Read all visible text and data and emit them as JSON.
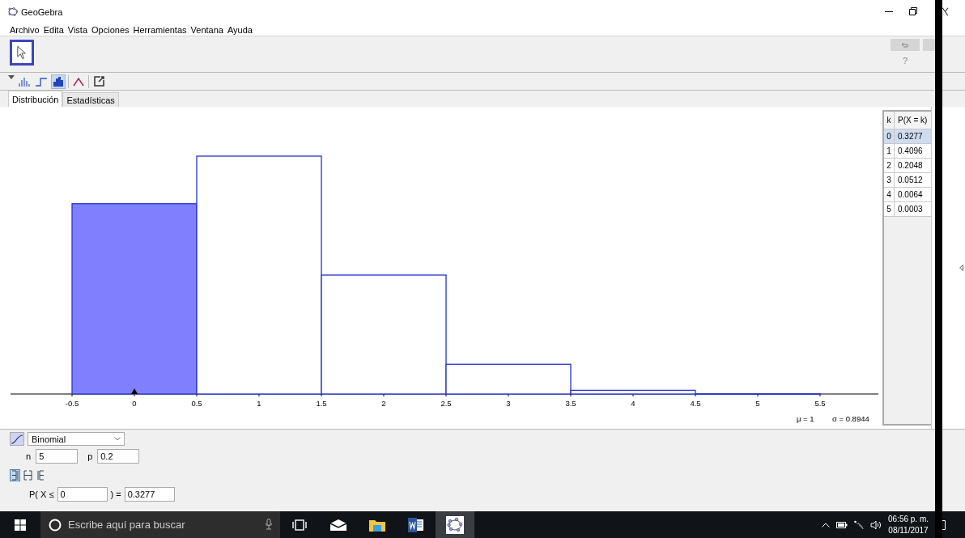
{
  "window": {
    "title": "GeoGebra"
  },
  "menu": [
    "Archivo",
    "Edita",
    "Vista",
    "Opciones",
    "Herramientas",
    "Ventana",
    "Ayuda"
  ],
  "help": "?",
  "view_buttons": [
    {
      "kind": "bars",
      "selected": false
    },
    {
      "kind": "step",
      "selected": false
    },
    {
      "kind": "histogram",
      "selected": true
    },
    {
      "kind": "curve",
      "selected": false
    },
    {
      "kind": "export",
      "selected": false
    }
  ],
  "tabs": [
    {
      "label": "Distribución",
      "selected": true
    },
    {
      "label": "Estadísticas",
      "selected": false
    }
  ],
  "histogram": {
    "axis_ticks": [
      "-0.5",
      "0",
      "0.5",
      "1",
      "1.5",
      "2",
      "2.5",
      "3",
      "3.5",
      "4",
      "4.5",
      "5",
      "5.5"
    ]
  },
  "summary": {
    "mean": "μ = 1",
    "sd": "σ = 0.8944"
  },
  "table": {
    "columns": [
      "k",
      "P(X = k)"
    ],
    "rows": [
      {
        "k": "0",
        "p": "0.3277",
        "selected": true
      },
      {
        "k": "1",
        "p": "0.4096",
        "selected": false
      },
      {
        "k": "2",
        "p": "0.2048",
        "selected": false
      },
      {
        "k": "3",
        "p": "0.0512",
        "selected": false
      },
      {
        "k": "4",
        "p": "0.0064",
        "selected": false
      },
      {
        "k": "5",
        "p": "0.0003",
        "selected": false
      }
    ]
  },
  "distribution": {
    "name": "Binomial",
    "cumulative": true,
    "params": [
      {
        "label": "n",
        "value": "5"
      },
      {
        "label": "p",
        "value": "0.2"
      }
    ],
    "interval_modes": [
      {
        "kind": "left",
        "selected": true
      },
      {
        "kind": "interval",
        "selected": false
      },
      {
        "kind": "right",
        "selected": false
      }
    ],
    "probability": {
      "prefix": "P( X ≤",
      "bound": "0",
      "suffix": ") =",
      "result": "0.3277"
    }
  },
  "taskbar": {
    "search_placeholder": "Escribe aquí para buscar",
    "apps": [
      {
        "kind": "taskview",
        "selected": false
      },
      {
        "kind": "mail",
        "selected": false
      },
      {
        "kind": "folder",
        "selected": false
      },
      {
        "kind": "word",
        "selected": false
      },
      {
        "kind": "geogebra",
        "selected": true
      }
    ],
    "time": "06:56 p. m.",
    "date": "08/11/2017"
  }
}
